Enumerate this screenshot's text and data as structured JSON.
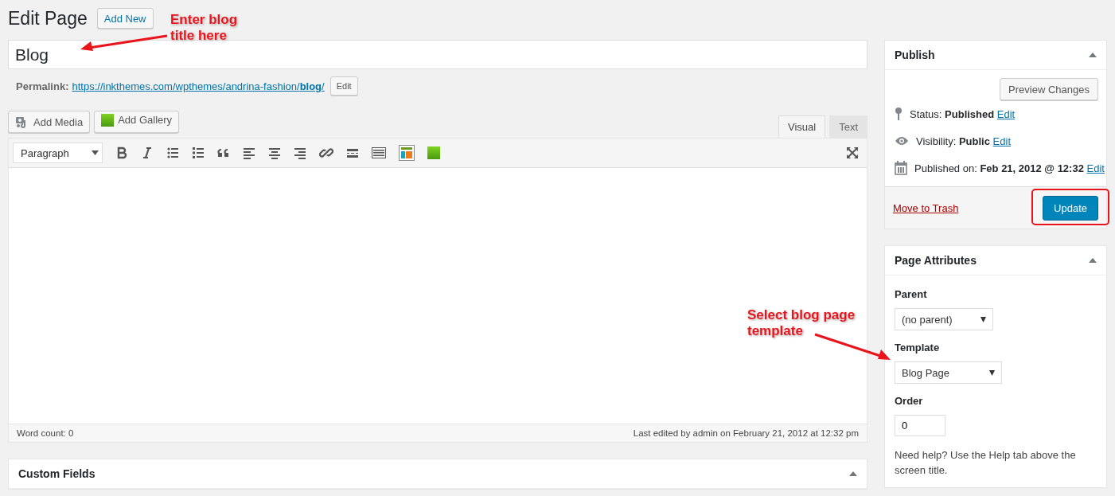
{
  "header": {
    "title": "Edit Page",
    "add_new": "Add New"
  },
  "title_field": {
    "value": "Blog"
  },
  "permalink": {
    "label": "Permalink:",
    "url": "https://inkthemes.com/wpthemes/andrina-fashion/**blog**/",
    "edit": "Edit"
  },
  "media_buttons": [
    {
      "kind": "media",
      "label": "Add Media"
    },
    {
      "kind": "gallery",
      "label": "Add Gallery"
    }
  ],
  "editor_tabs": [
    {
      "label": "Visual",
      "selected": true
    },
    {
      "label": "Text",
      "selected": false
    }
  ],
  "format_select": {
    "value": "Paragraph"
  },
  "toolbar": [
    {
      "kind": "bold"
    },
    {
      "kind": "italic"
    },
    {
      "kind": "bullet-list"
    },
    {
      "kind": "numbered-list"
    },
    {
      "kind": "quote"
    },
    {
      "kind": "align-left"
    },
    {
      "kind": "align-center"
    },
    {
      "kind": "align-right"
    },
    {
      "kind": "link"
    },
    {
      "kind": "read-more"
    },
    {
      "kind": "keyboard"
    },
    {
      "kind": "layout"
    },
    {
      "kind": "gallery"
    }
  ],
  "status_bar": {
    "word_count": "Word count: 0",
    "last_edited": "Last edited by admin on February 21, 2012 at 12:32 pm"
  },
  "custom_fields": {
    "title": "Custom Fields"
  },
  "publish": {
    "title": "Publish",
    "preview_button": "Preview Changes",
    "rows": [
      {
        "kind": "status",
        "text": "Status: **Published**",
        "link": "Edit"
      },
      {
        "kind": "visibility",
        "text": "Visibility: **Public**",
        "link": "Edit"
      },
      {
        "kind": "date",
        "text": "Published on: **Feb 21, 2012 @ 12:32**",
        "link": "Edit"
      }
    ],
    "trash_link": "Move to Trash",
    "update_button": "Update"
  },
  "page_attributes": {
    "title": "Page Attributes",
    "parent_label": "Parent",
    "parent_value": "(no parent)",
    "template_label": "Template",
    "template_value": "Blog Page",
    "order_label": "Order",
    "order_value": "0",
    "help": "Need help? Use the Help tab above the screen title."
  },
  "annotations": [
    {
      "text": "Enter blog title here"
    },
    {
      "text": "Select blog page template"
    }
  ]
}
